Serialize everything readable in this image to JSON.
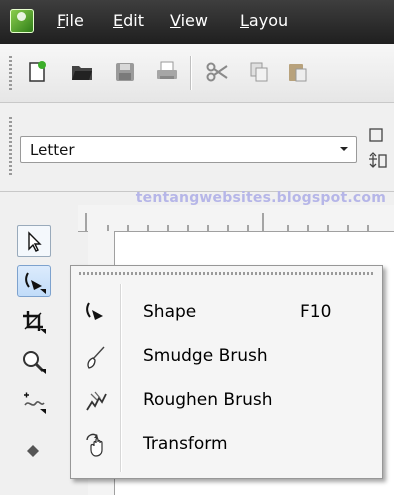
{
  "menubar": {
    "items": [
      {
        "label": "File",
        "accel": "F"
      },
      {
        "label": "Edit",
        "accel": "E"
      },
      {
        "label": "View",
        "accel": "V"
      },
      {
        "label": "Layou",
        "accel": "L"
      }
    ]
  },
  "toolbar": {
    "icons": [
      "new-document-icon",
      "open-folder-icon",
      "save-icon",
      "print-icon",
      "cut-icon",
      "copy-icon",
      "paste-icon"
    ]
  },
  "propbar": {
    "page_size": "Letter"
  },
  "watermark": "tentangwebsites.blogspot.com",
  "toolbox": {
    "tools": [
      "pick-tool-icon",
      "shape-tool-icon",
      "crop-tool-icon",
      "zoom-tool-icon",
      "freehand-tool-icon",
      "smart-fill-tool-icon"
    ]
  },
  "flyout": {
    "items": [
      {
        "label": "Shape",
        "shortcut": "F10",
        "icon": "shape-tool-icon"
      },
      {
        "label": "Smudge Brush",
        "shortcut": "",
        "icon": "smudge-brush-icon"
      },
      {
        "label": "Roughen Brush",
        "shortcut": "",
        "icon": "roughen-brush-icon"
      },
      {
        "label": "Transform",
        "shortcut": "",
        "icon": "transform-icon"
      }
    ]
  },
  "colors": {
    "menubar_bg": "#2b2b2b",
    "selection": "#c1dcf9",
    "watermark": "#b6b6e8"
  }
}
